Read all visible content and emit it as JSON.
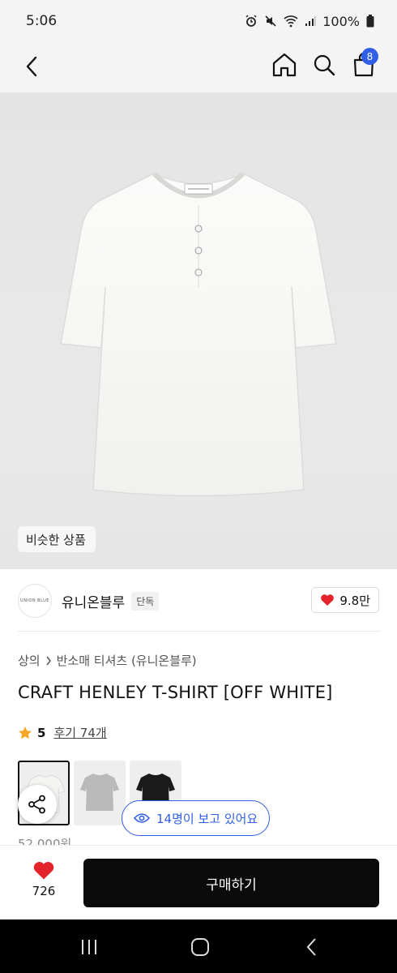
{
  "status_bar": {
    "time": "5:06",
    "battery": "100%"
  },
  "nav": {
    "cart_count": "8"
  },
  "hero": {
    "similar_label": "비슷한 상품"
  },
  "brand": {
    "logo_text": "UNION BLUE",
    "name": "유니온블루",
    "tag": "단독",
    "likes": "9.8만"
  },
  "breadcrumb": {
    "category": "상의",
    "subcategory": "반소매 티셔츠 (유니온블루)"
  },
  "product": {
    "title": "CRAFT HENLEY T-SHIRT [OFF WHITE]",
    "rating": "5",
    "reviews": "후기 74개",
    "price": "52,000원",
    "swatch_colors": [
      "#f2f2f0",
      "#b9b9b9",
      "#1a1a1a"
    ]
  },
  "viewers": {
    "text": "14명이 보고 있어요"
  },
  "bottom": {
    "wish_count": "726",
    "buy_label": "구매하기"
  },
  "colors": {
    "accent_blue": "#2f5fe8",
    "heart_red": "#e3242b",
    "star_orange": "#f5a623",
    "buy_bg": "#0b0b0b"
  }
}
